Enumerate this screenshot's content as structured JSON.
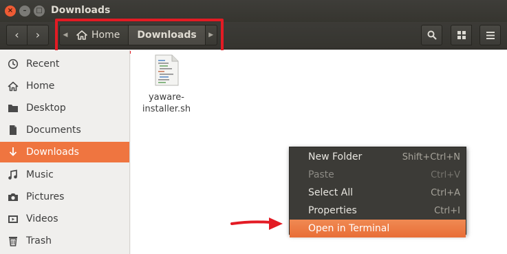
{
  "window": {
    "title": "Downloads",
    "close_glyph": "×",
    "min_glyph": "–",
    "max_glyph": "□"
  },
  "toolbar": {
    "back_glyph": "‹",
    "forward_glyph": "›",
    "path_left_glyph": "◀",
    "path_right_glyph": "▶",
    "breadcrumbs": [
      "Home",
      "Downloads"
    ],
    "icons": [
      "search-icon",
      "grid-view-icon",
      "hamburger-menu-icon"
    ]
  },
  "sidebar": {
    "items": [
      {
        "label": "Recent",
        "icon": "clock-icon"
      },
      {
        "label": "Home",
        "icon": "home-icon"
      },
      {
        "label": "Desktop",
        "icon": "folder-icon"
      },
      {
        "label": "Documents",
        "icon": "document-icon"
      },
      {
        "label": "Downloads",
        "icon": "download-icon",
        "active": true
      },
      {
        "label": "Music",
        "icon": "music-icon"
      },
      {
        "label": "Pictures",
        "icon": "camera-icon"
      },
      {
        "label": "Videos",
        "icon": "video-icon"
      },
      {
        "label": "Trash",
        "icon": "trash-icon"
      }
    ]
  },
  "content": {
    "files": [
      {
        "name_line1": "yaware-",
        "name_line2": "installer.sh",
        "icon": "shell-script-icon"
      }
    ]
  },
  "context_menu": {
    "items": [
      {
        "label": "New Folder",
        "shortcut": "Shift+Ctrl+N",
        "state": "normal"
      },
      {
        "label": "Paste",
        "shortcut": "Ctrl+V",
        "state": "disabled"
      },
      {
        "label": "Select All",
        "shortcut": "Ctrl+A",
        "state": "normal"
      },
      {
        "label": "Properties",
        "shortcut": "Ctrl+I",
        "state": "normal"
      },
      {
        "label": "Open in Terminal",
        "shortcut": "",
        "state": "highlighted"
      }
    ]
  },
  "colors": {
    "accent": "#ef7540",
    "annotation": "#e31b24",
    "titlebar": "#3c3b37"
  }
}
